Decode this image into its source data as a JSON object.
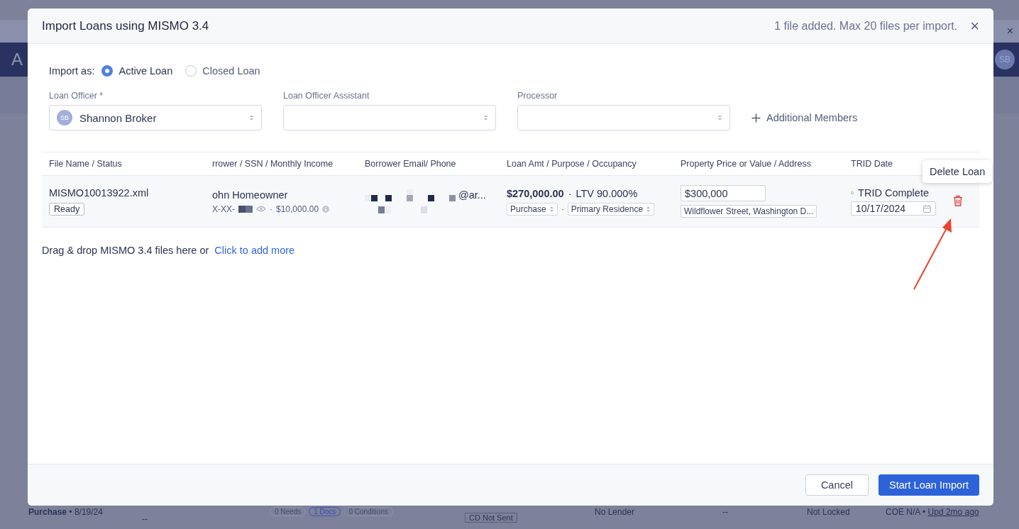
{
  "background_page": {
    "logo_letter": "A",
    "avatar": "SB",
    "close": "×",
    "row": {
      "loan": "**Purchase** • 8/19/24",
      "column_2": "--",
      "tags": [
        {
          "label": "0 Needs",
          "highlighted": false
        },
        {
          "label": "1 Docs",
          "highlighted": true
        },
        {
          "label": "0 Conditions",
          "highlighted": false
        }
      ],
      "cd_status": "CD Not Sent",
      "lender": "No Lender",
      "column_6": "--",
      "lock": "Not Locked",
      "coe": "COE N/A •",
      "updated": "Upd 2mo ago"
    }
  },
  "modal": {
    "title": "Import Loans using MISMO 3.4",
    "file_note": "1 file added. Max 20 files per import.",
    "close": "×",
    "import_as": {
      "label": "Import as:",
      "options": [
        {
          "label": "Active Loan",
          "selected": true
        },
        {
          "label": "Closed Loan",
          "selected": false
        }
      ]
    },
    "team": [
      {
        "label": "Loan Officer *",
        "value": "Shannon Broker",
        "avatar": "SB"
      },
      {
        "label": "Loan Officer Assistant"
      },
      {
        "label": "Processor"
      }
    ],
    "additional_members": "Additional Members",
    "table": {
      "columns": [
        "File Name / Status",
        "rrower / SSN / Monthly Income",
        "Borrower Email/ Phone",
        "Loan Amt / Purpose / Occupancy",
        "Property Price or Value / Address",
        "TRID Date"
      ],
      "rows": [
        {
          "file_name": "MISMO10013922.xml",
          "status": "Ready",
          "borrower": "ohn Homeowner",
          "ssn": "X-XX-",
          "income_separator": "·",
          "income": "$10,000.00",
          "email": "@ar...",
          "loan_amount": "$270,000.00",
          "ltv_separator": "·",
          "ltv": "LTV 90.000%",
          "purpose": "Purchase",
          "purpose_separator": "·",
          "occupancy": "Primary Residence",
          "property_value": "$300,000",
          "address": "Wildflower Street, Washington D...",
          "trid_status": "TRID Complete",
          "trid_date": "10/17/2024"
        }
      ]
    },
    "tooltip": "Delete Loan",
    "dropzone": {
      "text": "Drag & drop MISMO 3.4 files here or",
      "link": "Click to add more"
    },
    "buttons": [
      {
        "label": "Cancel",
        "kind": "secondary"
      },
      {
        "label": "Start Loan Import",
        "kind": "primary"
      }
    ]
  }
}
